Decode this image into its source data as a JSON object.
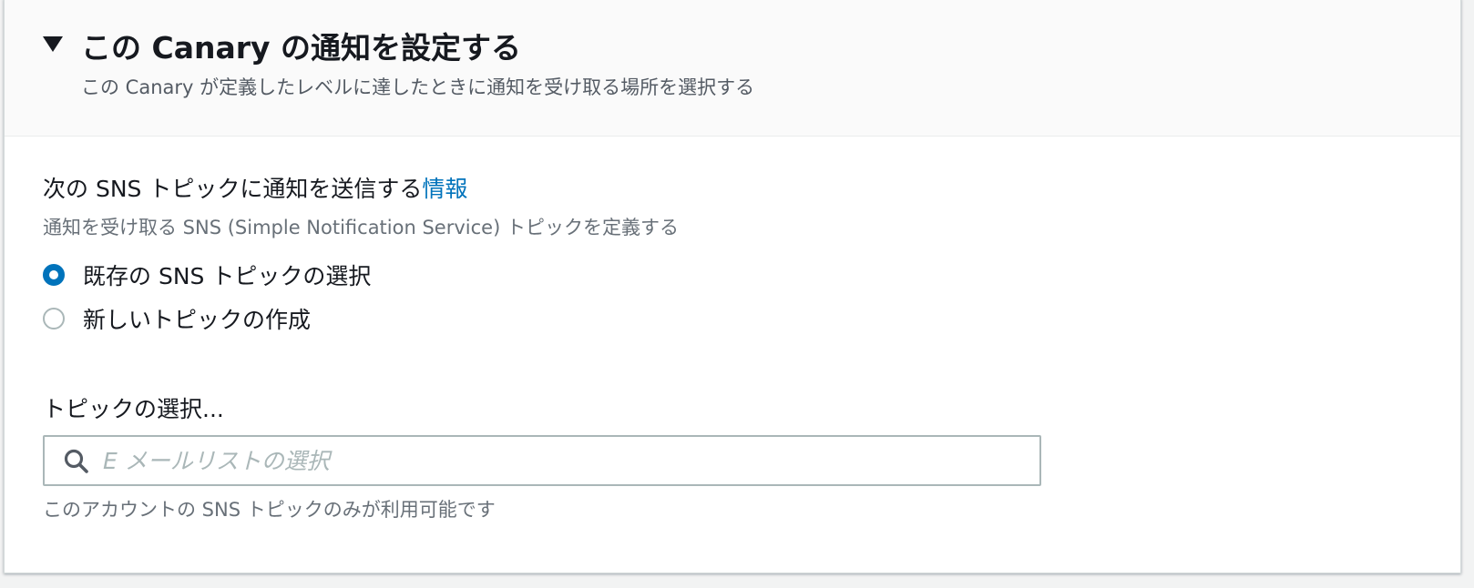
{
  "header": {
    "title": "この Canary の通知を設定する",
    "description": "この Canary が定義したレベルに達したときに通知を受け取る場所を選択する"
  },
  "sns_section": {
    "label": "次の SNS トピックに通知を送信する",
    "info_link": "情報",
    "description": "通知を受け取る SNS (Simple Notification Service) トピックを定義する",
    "options": [
      {
        "label": "既存の SNS トピックの選択",
        "selected": true
      },
      {
        "label": "新しいトピックの作成",
        "selected": false
      }
    ]
  },
  "topic_select": {
    "label": "トピックの選択...",
    "placeholder": "E メールリストの選択",
    "value": "",
    "hint": "このアカウントの SNS トピックのみが利用可能です"
  },
  "colors": {
    "accent": "#0073bb",
    "text": "#16191f",
    "secondary_text": "#687078",
    "border": "#aab7b8"
  }
}
